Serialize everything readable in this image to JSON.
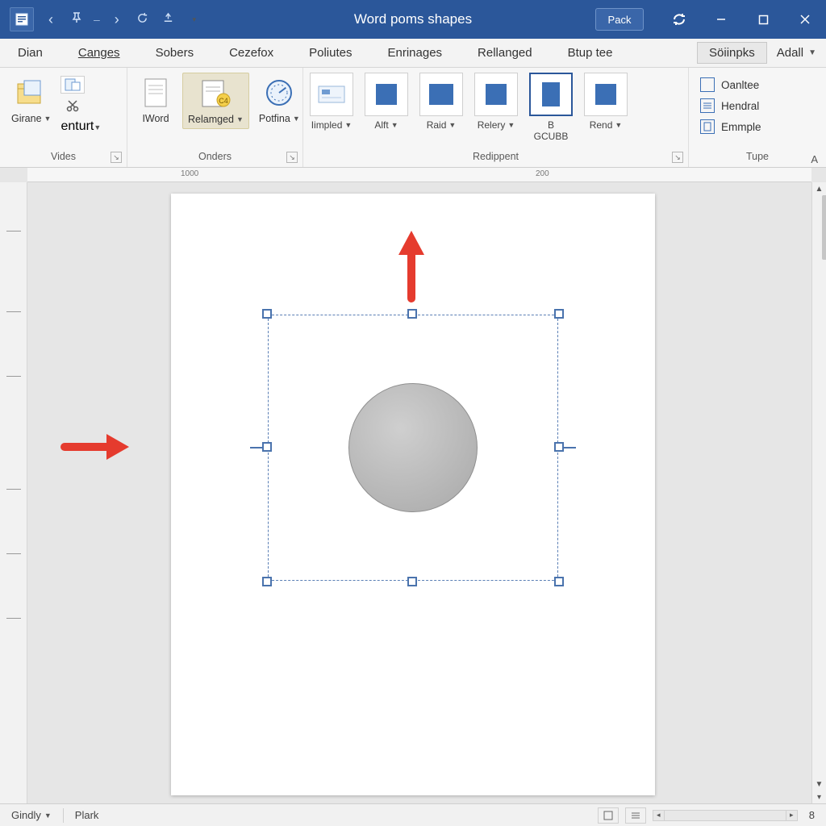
{
  "app": {
    "title": "Word poms shapes",
    "back_label": "Pack"
  },
  "qat": {
    "items": [
      "app-icon",
      "nav-back",
      "pin",
      "sep",
      "nav-fwd",
      "refresh",
      "touch",
      "more"
    ]
  },
  "tabs": {
    "items": [
      "Dian",
      "Canges",
      "Sobers",
      "Cezefox",
      "Poliutes",
      "Enrinages",
      "Rellanged",
      "Btup tee"
    ],
    "control": "Söiinpks",
    "extra": "Adall"
  },
  "ribbon": {
    "group1": {
      "label": "Vides",
      "btn1": "Girane",
      "btn2": "enturt"
    },
    "group2": {
      "label": "Onders",
      "btn1": "IWord",
      "btn2": "Relamged",
      "btn3": "Potfina"
    },
    "group3": {
      "label": "Redippent",
      "items": [
        {
          "label": "Iimpled"
        },
        {
          "label": "Alft"
        },
        {
          "label": "Raid"
        },
        {
          "label": "Relery"
        },
        {
          "label": "B GCUBB",
          "selected": true
        },
        {
          "label": "Rend"
        }
      ]
    },
    "group4": {
      "label": "Tupe",
      "items": [
        "Oanltee",
        "Hendral",
        "Emmple"
      ]
    },
    "corner": "A"
  },
  "ruler": {
    "mark1": "1000",
    "mark2": "200"
  },
  "statusbar": {
    "left1": "Gindly",
    "left2": "Plark",
    "right_count": "8"
  },
  "colors": {
    "brand": "#2b579a",
    "accent": "#3b6fb5",
    "arrow": "#e53b2e"
  }
}
